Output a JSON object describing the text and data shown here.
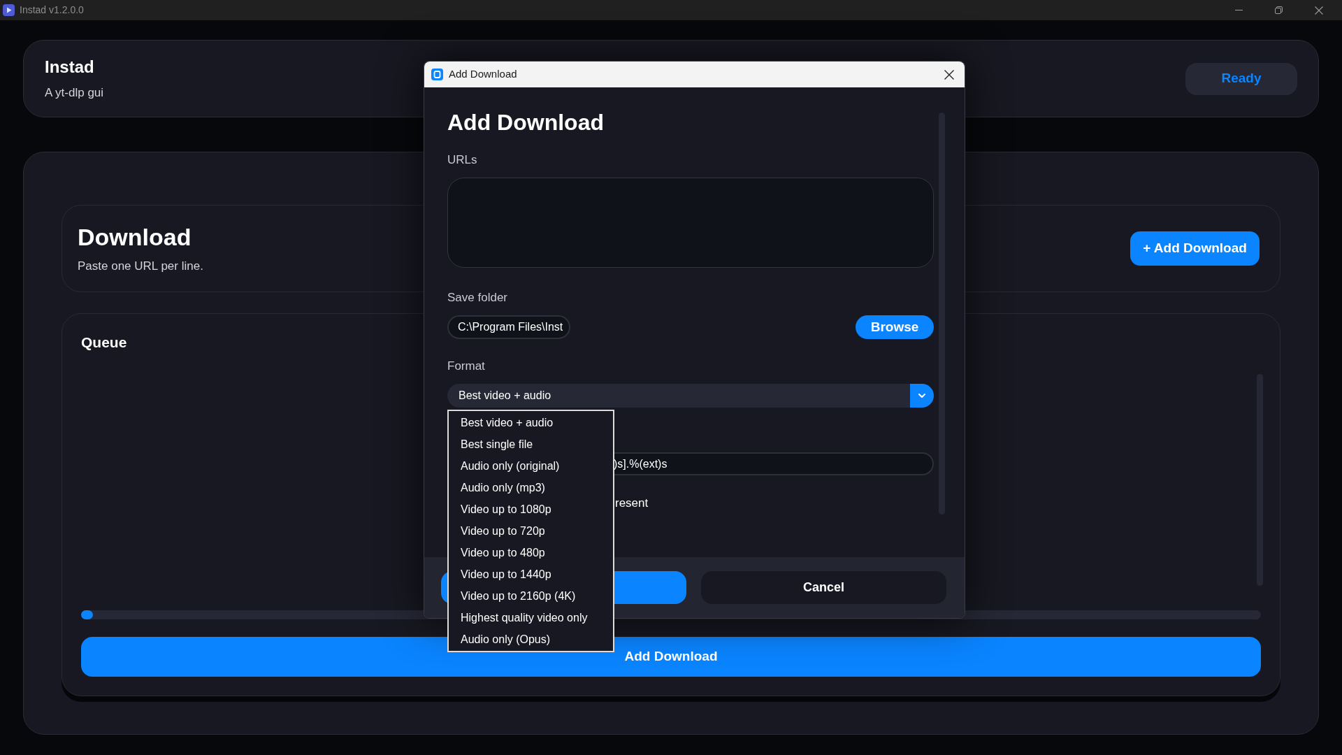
{
  "window": {
    "title": "Instad v1.2.0.0"
  },
  "header": {
    "title": "Instad",
    "subtitle": "A yt-dlp gui",
    "status": "Ready"
  },
  "download_panel": {
    "title": "Download",
    "hint": "Paste one URL per line.",
    "add_button": "+ Add Download"
  },
  "queue": {
    "title": "Queue",
    "progress": {
      "level": 0.01
    },
    "add_button": "Add Download"
  },
  "dialog": {
    "title": "Add Download",
    "heading": "Add Download",
    "urls": {
      "label": "URLs"
    },
    "save_folder": {
      "label": "Save folder",
      "value": "C:\\Program Files\\Inst",
      "browse_button": "Browse"
    },
    "format": {
      "label": "Format",
      "value": "Best video + audio",
      "expanded": true,
      "options": [
        "Best video + audio",
        "Best single file",
        "Audio only (original)",
        "Audio only (mp3)",
        "Video up to 1080p",
        "Video up to 720p",
        "Video up to 480p",
        "Video up to 1440p",
        "Video up to 2160p (4K)",
        "Highest quality video only",
        "Audio only (Opus)"
      ]
    },
    "pattern_field": {
      "value": ")s].%(ext)s"
    },
    "option_text": "resent",
    "buttons": [
      {
        "kind": "primary"
      },
      {
        "kind": "secondary",
        "label": "Cancel"
      }
    ]
  }
}
